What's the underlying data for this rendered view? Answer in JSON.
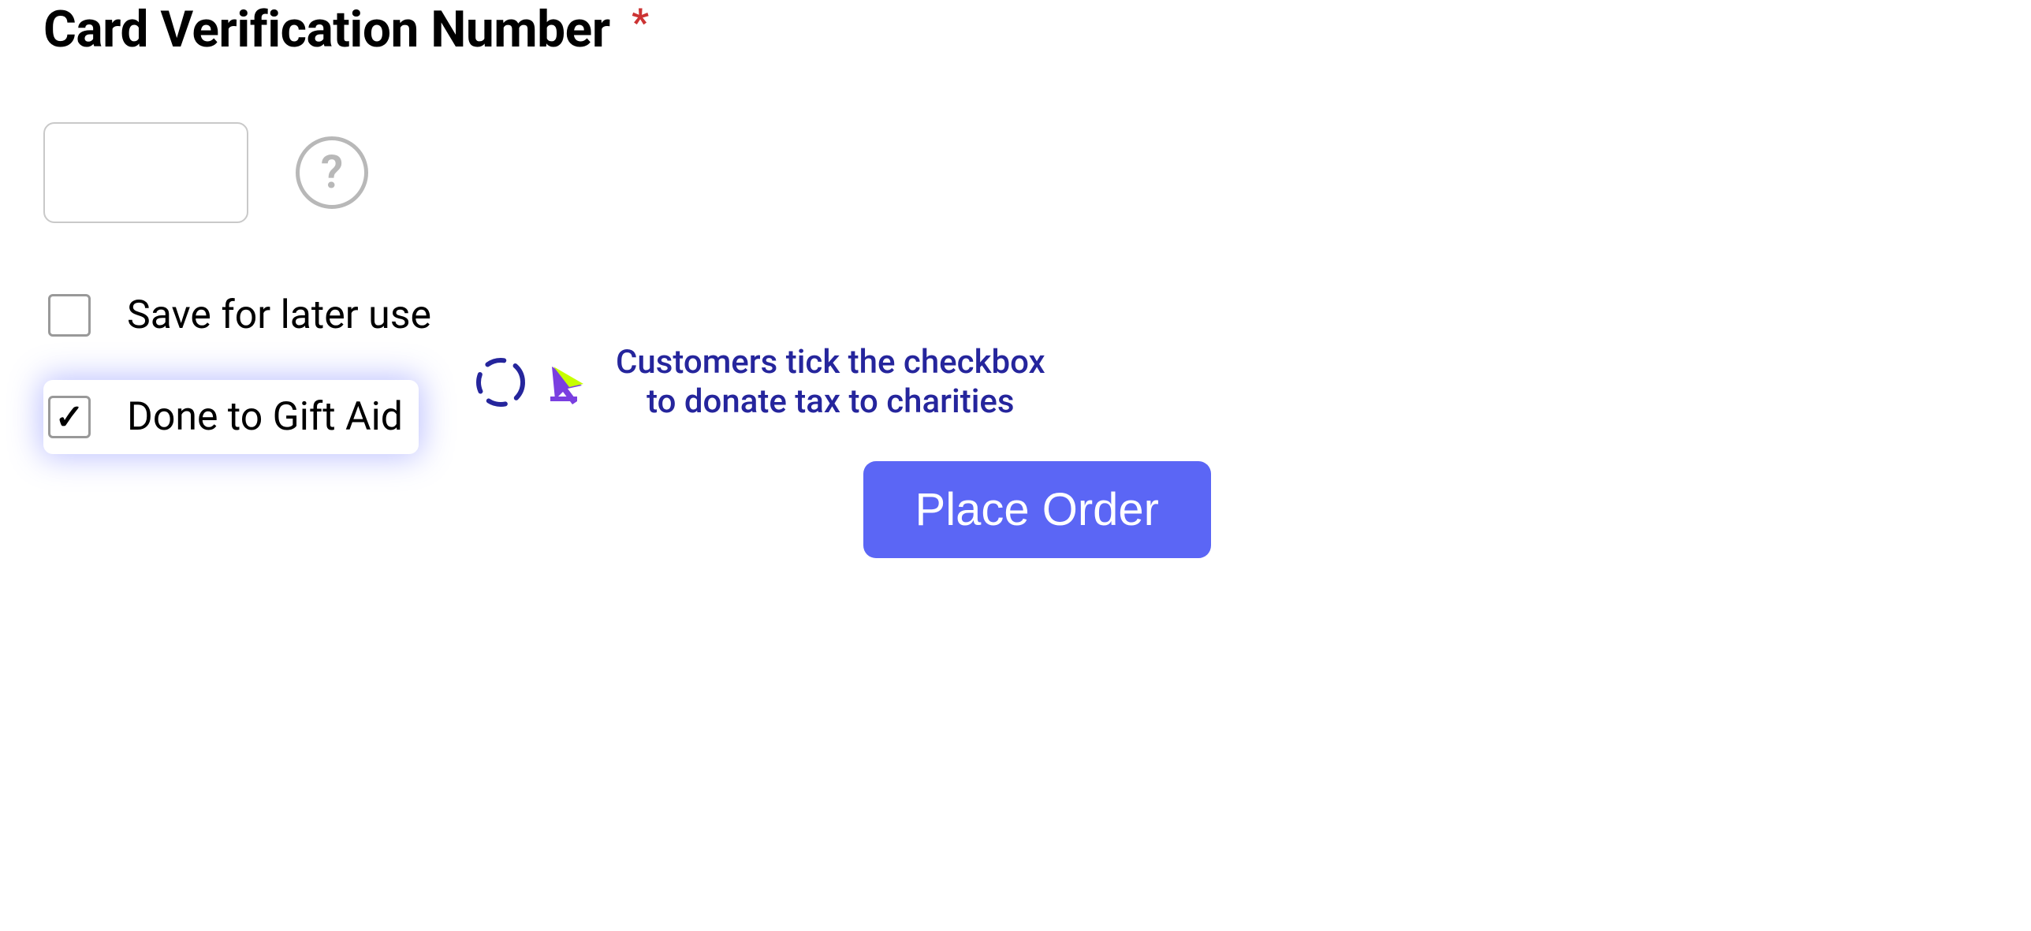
{
  "section": {
    "title": "Card Verification Number",
    "required_marker": "*"
  },
  "cvv": {
    "value": "",
    "placeholder": ""
  },
  "help": {
    "glyph": "?"
  },
  "checkboxes": {
    "save": {
      "label": "Save for later use",
      "checked": false
    },
    "gift_aid": {
      "label": "Done to Gift Aid",
      "checked": true
    }
  },
  "annotation": {
    "line1": "Customers tick the checkbox",
    "line2": "to donate tax to charities"
  },
  "buttons": {
    "place_order": "Place Order"
  },
  "colors": {
    "primary_button": "#5b66f5",
    "annotation_text": "#25259c",
    "required": "#cc3333"
  }
}
